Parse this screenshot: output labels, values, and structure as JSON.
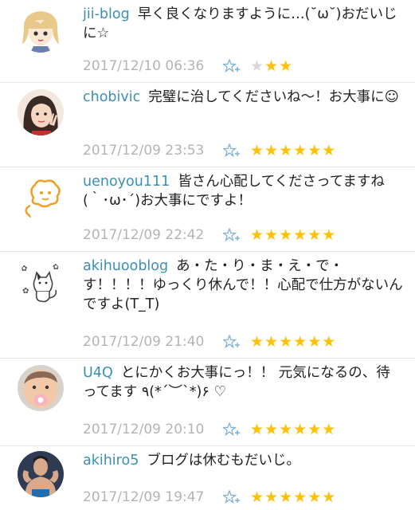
{
  "colors": {
    "name": "#3b8fb5",
    "date": "#b4b4b4",
    "star_on": "#ffc107",
    "star_off": "#d9d9d9",
    "star_add": "#7fb2d8"
  },
  "comments": [
    {
      "user": "jii-blog",
      "text": "早く良くなりますように…(˘ω˘)おだいじに☆",
      "date": "2017/12/10 06:36",
      "stars_filled": 2,
      "stars_empty": 1,
      "avatar_icon": "anime-girl-avatar-icon"
    },
    {
      "user": "chobivic",
      "text": "完璧に治してくださいね〜！お大事に☺",
      "date": "2017/12/09 23:53",
      "stars_filled": 6,
      "stars_empty": 0,
      "avatar_icon": "girl-peace-avatar-icon"
    },
    {
      "user": "uenoyou111",
      "text": "皆さん心配してくださってますね(｀･ω･´)お大事にですよ！",
      "date": "2017/12/09 22:42",
      "stars_filled": 6,
      "stars_empty": 0,
      "avatar_icon": "orange-doodle-avatar-icon"
    },
    {
      "user": "akihuooblog",
      "text": "あ・た・り・ま・え・で・す！！！！ゆっくり休んで！！心配で仕方がないんですよ(T_T)",
      "date": "2017/12/09 21:40",
      "stars_filled": 6,
      "stars_empty": 0,
      "avatar_icon": "cat-sketch-avatar-icon"
    },
    {
      "user": "U4Q",
      "text": "とにかくお大事にっ！！ 元気になるの、待ってます ٩(*´︶`*)۶ ♡",
      "date": "2017/12/09 20:10",
      "stars_filled": 6,
      "stars_empty": 0,
      "avatar_icon": "baby-face-avatar-icon"
    },
    {
      "user": "akihiro5",
      "text": "ブログは休むもだいじ。",
      "date": "2017/12/09 19:47",
      "stars_filled": 6,
      "stars_empty": 0,
      "avatar_icon": "muscle-man-avatar-icon"
    }
  ]
}
